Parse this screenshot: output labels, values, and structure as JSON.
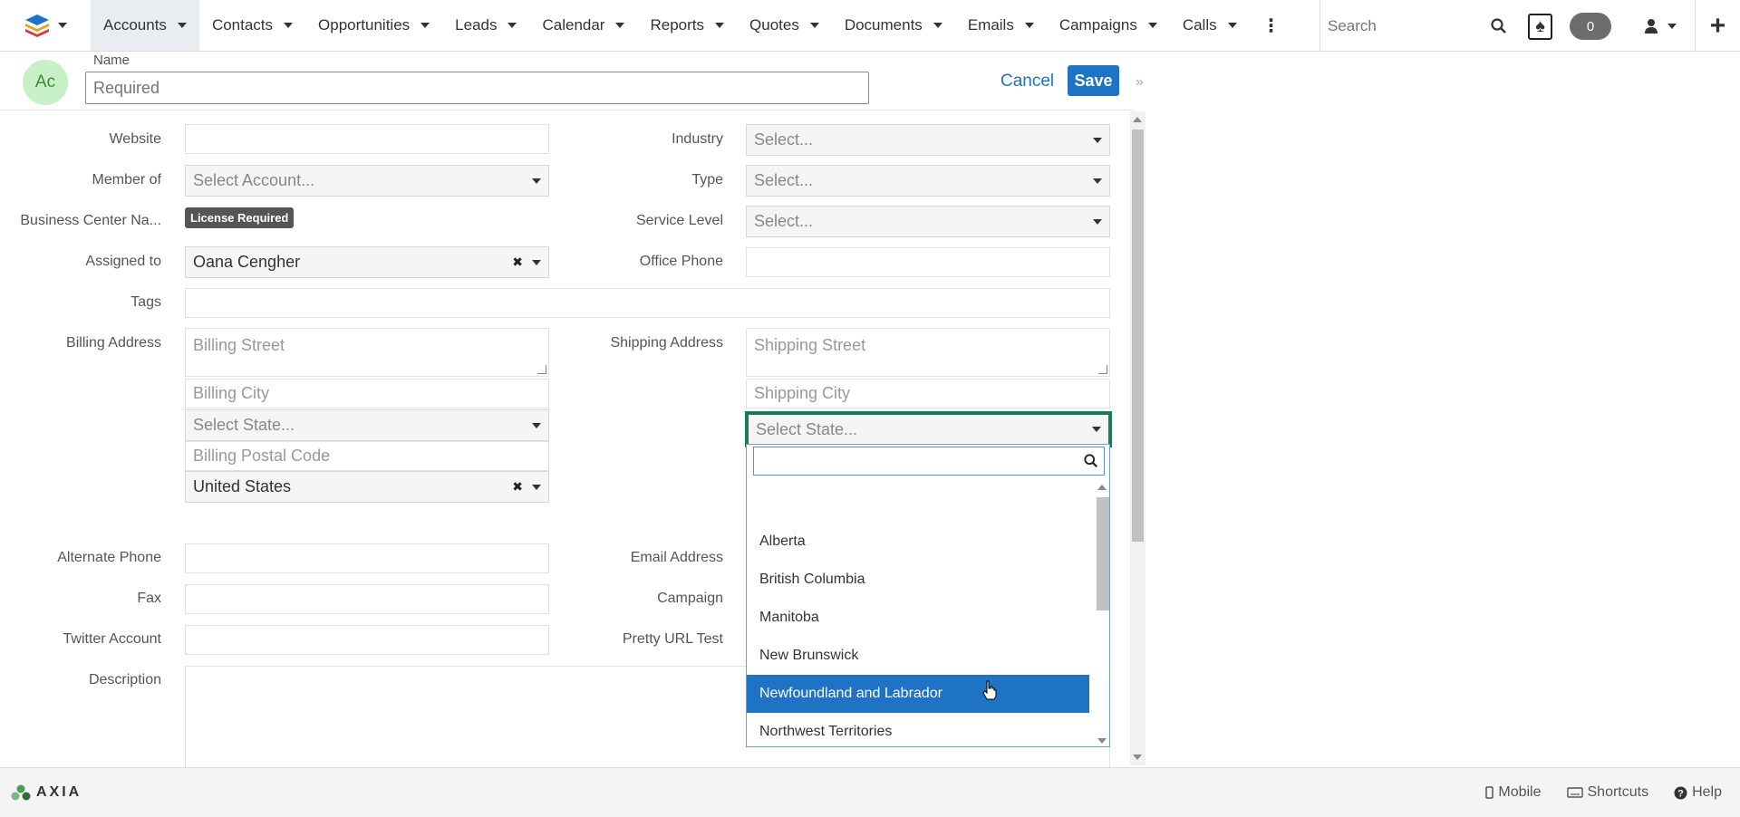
{
  "nav": {
    "items": [
      {
        "label": "Accounts",
        "active": true
      },
      {
        "label": "Contacts"
      },
      {
        "label": "Opportunities"
      },
      {
        "label": "Leads"
      },
      {
        "label": "Calendar"
      },
      {
        "label": "Reports"
      },
      {
        "label": "Quotes"
      },
      {
        "label": "Documents"
      },
      {
        "label": "Emails"
      },
      {
        "label": "Campaigns"
      },
      {
        "label": "Calls"
      }
    ],
    "search_placeholder": "Search",
    "notification_count": "0"
  },
  "header": {
    "avatar_initials": "Ac",
    "name_label": "Name",
    "name_placeholder": "Required",
    "cancel_label": "Cancel",
    "save_label": "Save"
  },
  "form": {
    "website_label": "Website",
    "member_of_label": "Member of",
    "member_of_placeholder": "Select Account...",
    "business_center_label": "Business Center Na...",
    "license_badge": "License Required",
    "assigned_to_label": "Assigned to",
    "assigned_to_value": "Oana Cengher",
    "tags_label": "Tags",
    "billing_address_label": "Billing Address",
    "billing_street_placeholder": "Billing Street",
    "billing_city_placeholder": "Billing City",
    "billing_state_placeholder": "Select State...",
    "billing_postal_placeholder": "Billing Postal Code",
    "billing_country_value": "United States",
    "industry_label": "Industry",
    "industry_placeholder": "Select...",
    "type_label": "Type",
    "type_placeholder": "Select...",
    "service_level_label": "Service Level",
    "service_level_placeholder": "Select...",
    "office_phone_label": "Office Phone",
    "shipping_address_label": "Shipping Address",
    "shipping_street_placeholder": "Shipping Street",
    "shipping_city_placeholder": "Shipping City",
    "shipping_state_placeholder": "Select State...",
    "alternate_phone_label": "Alternate Phone",
    "fax_label": "Fax",
    "twitter_label": "Twitter Account",
    "description_label": "Description",
    "email_address_label": "Email Address",
    "campaign_label": "Campaign",
    "pretty_url_label": "Pretty URL Test"
  },
  "dropdown": {
    "options": [
      {
        "label": ""
      },
      {
        "label": "Alberta"
      },
      {
        "label": "British Columbia"
      },
      {
        "label": "Manitoba"
      },
      {
        "label": "New Brunswick"
      },
      {
        "label": "Newfoundland and Labrador",
        "highlighted": true
      },
      {
        "label": "Northwest Territories"
      }
    ]
  },
  "footer": {
    "brand": "AXIA",
    "mobile_label": "Mobile",
    "shortcuts_label": "Shortcuts",
    "help_label": "Help"
  },
  "colors": {
    "accent": "#1f73c4",
    "focus_border": "#1a7a5a",
    "avatar_bg": "#c8f0c8"
  }
}
